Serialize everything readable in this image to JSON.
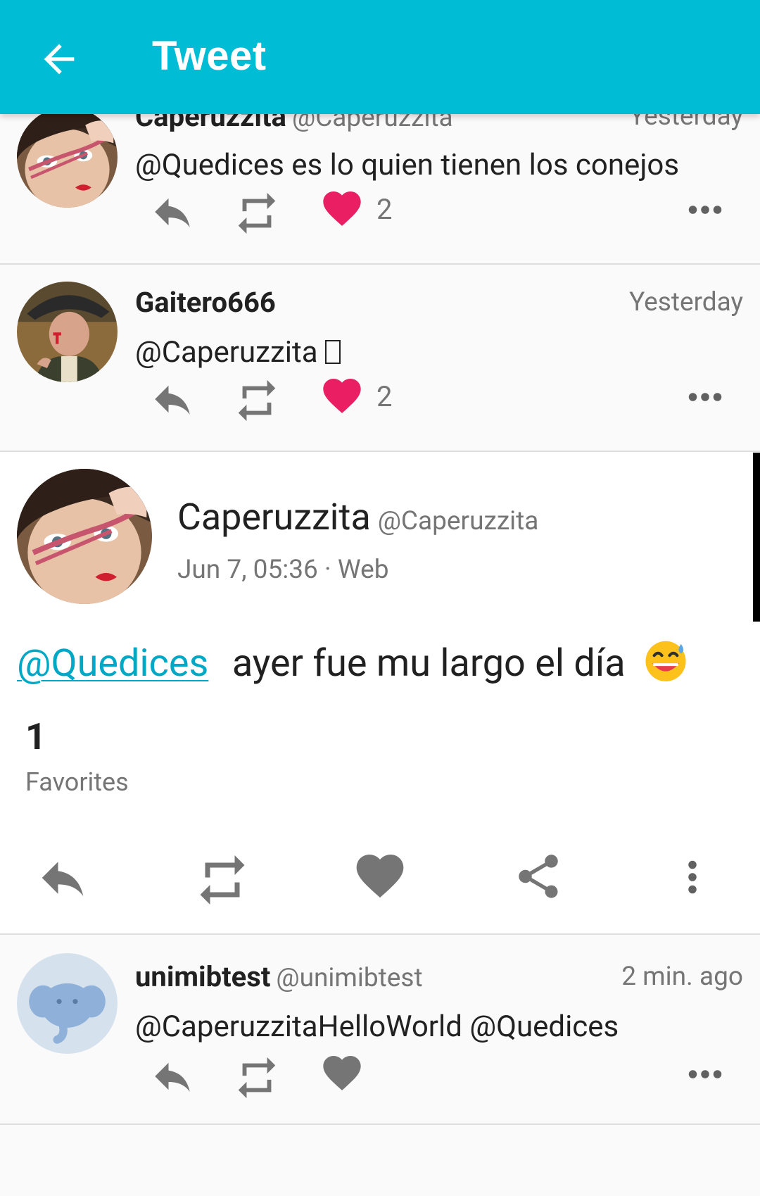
{
  "appbar": {
    "title": "Tweet",
    "back_icon": "arrow-back-icon"
  },
  "replies": [
    {
      "name": "Caperuzzita",
      "handle": "@Caperuzzita",
      "time": "Yesterday",
      "text": "@Quedices es lo quien tienen los conejos",
      "likes": "2",
      "liked": true
    },
    {
      "name": "Gaitero666",
      "handle": "",
      "time": "Yesterday",
      "text": "@Caperuzzita ",
      "likes": "2",
      "liked": true
    }
  ],
  "main_tweet": {
    "name": "Caperuzzita",
    "handle": "@Caperuzzita",
    "meta": "Jun 7, 05:36 · Web",
    "mention": "@Quedices",
    "text": "ayer fue mu largo el día",
    "emoji": "grinning-sweat-emoji",
    "favorites_count": "1",
    "favorites_label": "Favorites"
  },
  "bottom_reply": {
    "name": "unimibtest",
    "handle": "@unimibtest",
    "time": "2 min. ago",
    "text": "@CaperuzzitaHelloWorld @Quedices",
    "liked": false
  },
  "colors": {
    "appbar": "#00bcd4",
    "accent_link": "#00a8c6",
    "heart_active": "#e91e63",
    "icon_gray": "#757575"
  }
}
